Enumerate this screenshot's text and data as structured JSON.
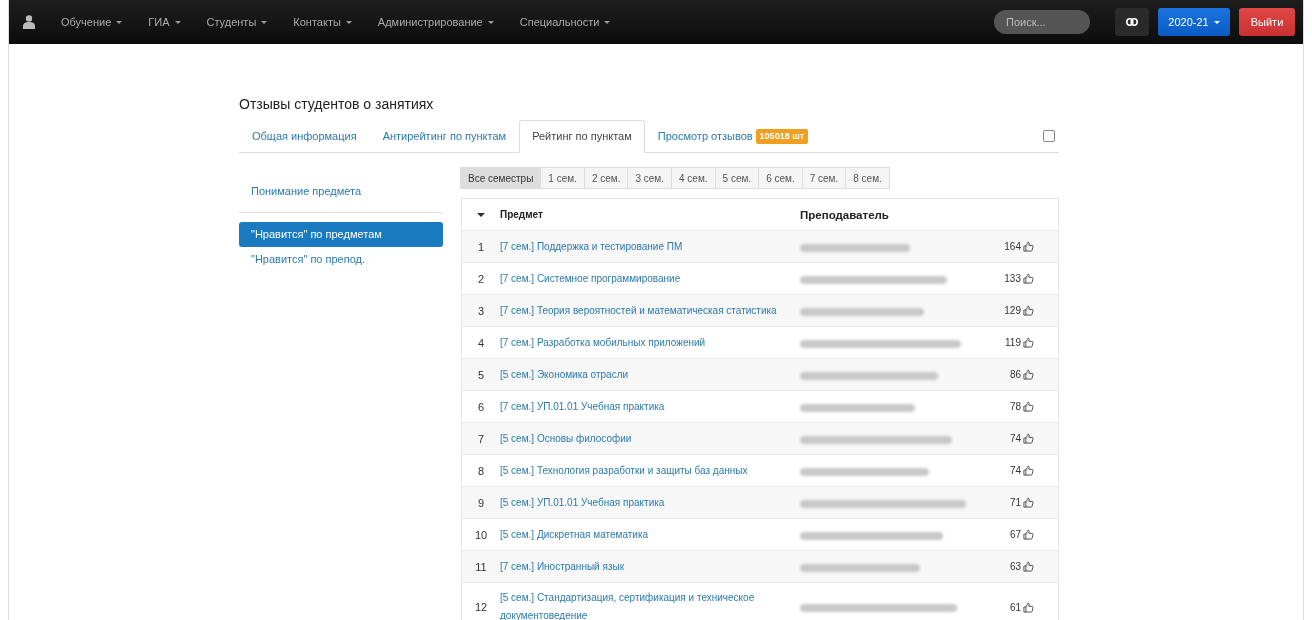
{
  "navbar": {
    "menu": [
      {
        "label": "Обучение",
        "dropdown": true
      },
      {
        "label": "ГИА",
        "dropdown": true
      },
      {
        "label": "Студенты",
        "dropdown": true
      },
      {
        "label": "Контакты",
        "dropdown": true
      },
      {
        "label": "Администрирование",
        "dropdown": true
      },
      {
        "label": "Специальности",
        "dropdown": true
      }
    ],
    "search": {
      "placeholder": "Поиск..."
    },
    "year": {
      "label": "2020-21",
      "dropdown": true
    },
    "logout": {
      "label": "Выйти"
    }
  },
  "page_title": "Отзывы студентов о занятиях",
  "tabs": [
    {
      "label": "Общая информация",
      "selected": false
    },
    {
      "label": "Антирейтинг по пунктам",
      "selected": false
    },
    {
      "label": "Рейтинг по пунктам",
      "selected": true
    },
    {
      "label": "Просмотр отзывов",
      "selected": false,
      "badge": "105018 шт"
    }
  ],
  "tabs_checkbox": {
    "checked": false
  },
  "side_menu": [
    {
      "items": [
        {
          "label": "Понимание предмета",
          "selected": false
        }
      ]
    },
    {
      "items": [
        {
          "label": "\"Нравится\" по предметам",
          "selected": true
        },
        {
          "label": "\"Нравится\" по препод.",
          "selected": false
        }
      ]
    }
  ],
  "semester_filter": [
    {
      "label": "Все семестры",
      "selected": true
    },
    {
      "label": "1 сем.",
      "selected": false
    },
    {
      "label": "2 сем.",
      "selected": false
    },
    {
      "label": "3 сем.",
      "selected": false
    },
    {
      "label": "4 сем.",
      "selected": false
    },
    {
      "label": "5 сем.",
      "selected": false
    },
    {
      "label": "6 сем.",
      "selected": false
    },
    {
      "label": "7 сем.",
      "selected": false
    },
    {
      "label": "8 сем.",
      "selected": false
    }
  ],
  "table": {
    "columns": [
      "Предмет",
      "Преподаватель"
    ],
    "rows": [
      {
        "rank": "1",
        "subject": "[7 сем.] Поддержка и тестирование ПМ",
        "likes": "164"
      },
      {
        "rank": "2",
        "subject": "[7 сем.] Системное программирование",
        "likes": "133"
      },
      {
        "rank": "3",
        "subject": "[7 сем.] Теория вероятностей и математическая статистика",
        "likes": "129"
      },
      {
        "rank": "4",
        "subject": "[7 сем.] Разработка мобильных приложений",
        "likes": "119"
      },
      {
        "rank": "5",
        "subject": "[5 сем.] Экономика отрасли",
        "likes": "86"
      },
      {
        "rank": "6",
        "subject": "[7 сем.] УП.01.01 Учебная практика",
        "likes": "78"
      },
      {
        "rank": "7",
        "subject": "[5 сем.] Основы философии",
        "likes": "74"
      },
      {
        "rank": "8",
        "subject": "[5 сем.] Технология разработки и защиты баз данных",
        "likes": "74"
      },
      {
        "rank": "9",
        "subject": "[5 сем.] УП.01.01 Учебная практика",
        "likes": "71"
      },
      {
        "rank": "10",
        "subject": "[5 сем.] Дискретная математика",
        "likes": "67"
      },
      {
        "rank": "11",
        "subject": "[7 сем.] Иностранный язык",
        "likes": "63"
      },
      {
        "rank": "12",
        "subject": "[5 сем.] Стандартизация, сертификация и техническое документоведение",
        "likes": "61"
      }
    ]
  }
}
